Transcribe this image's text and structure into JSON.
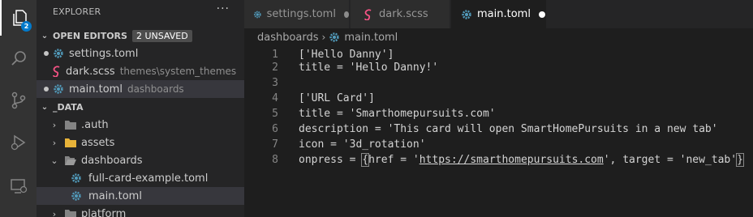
{
  "activity_bar": {
    "explorer_badge": "2",
    "items": [
      "explorer",
      "search",
      "source-control",
      "run-debug",
      "remote-explorer"
    ]
  },
  "sidebar": {
    "title": "EXPLORER",
    "more": "···",
    "open_editors": {
      "label": "OPEN EDITORS",
      "badge": "2 UNSAVED",
      "items": [
        {
          "name": "settings.toml",
          "desc": "",
          "unsaved": true
        },
        {
          "name": "dark.scss",
          "desc": "themes\\system_themes",
          "unsaved": false
        },
        {
          "name": "main.toml",
          "desc": "dashboards",
          "unsaved": true
        }
      ]
    },
    "folder": {
      "label": "_DATA",
      "items": [
        {
          "name": ".auth",
          "kind": "folder-collapsed"
        },
        {
          "name": "assets",
          "kind": "folder-collapsed"
        },
        {
          "name": "dashboards",
          "kind": "folder-open"
        },
        {
          "name": "full-card-example.toml",
          "kind": "file"
        },
        {
          "name": "main.toml",
          "kind": "file"
        },
        {
          "name": "platform",
          "kind": "folder-collapsed"
        }
      ]
    }
  },
  "tabs": [
    {
      "label": "settings.toml",
      "active": false,
      "unsaved": true
    },
    {
      "label": "dark.scss",
      "active": false,
      "unsaved": false
    },
    {
      "label": "main.toml",
      "active": true,
      "unsaved": true
    }
  ],
  "breadcrumb": {
    "folder": "dashboards",
    "file": "main.toml"
  },
  "editor": {
    "lines": [
      {
        "n": "1",
        "text": "['Hello Danny']"
      },
      {
        "n": "2",
        "text": "title = 'Hello Danny!'"
      },
      {
        "n": "3",
        "text": ""
      },
      {
        "n": "4",
        "text": "['URL Card']"
      },
      {
        "n": "5",
        "text": "title = 'Smarthomepursuits.com'"
      },
      {
        "n": "6",
        "text": "description = 'This card will open SmartHomePursuits in a new tab'"
      },
      {
        "n": "7",
        "text": "icon = '3d_rotation'"
      },
      {
        "n": "8",
        "text": "onpress = {href = 'https://smarthomepursuits.com', target = 'new_tab'}"
      }
    ],
    "line8_parts": {
      "pre": "onpress = ",
      "open": "{",
      "mid1": "href = '",
      "url": "https://smarthomepursuits.com",
      "mid2": "', target = 'new_tab'",
      "close": "}"
    }
  },
  "colors": {
    "accent": "#007acc",
    "toml_icon": "#519aba",
    "scss_icon": "#f55385",
    "folder": "#c09553"
  }
}
